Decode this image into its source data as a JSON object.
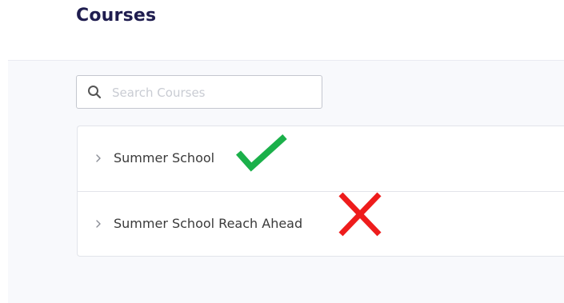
{
  "header": {
    "title": "Courses"
  },
  "search": {
    "placeholder": "Search Courses",
    "value": ""
  },
  "courses": [
    {
      "label": "Summer School",
      "marker": "check-mark-icon",
      "marker_color": "#1bb04a"
    },
    {
      "label": "Summer School Reach Ahead",
      "marker": "cross-mark-icon",
      "marker_color": "#ee1c1c"
    }
  ],
  "colors": {
    "title": "#1f1d4f",
    "background": "#f8f9fc",
    "check": "#1bb04a",
    "cross": "#ee1c1c"
  }
}
